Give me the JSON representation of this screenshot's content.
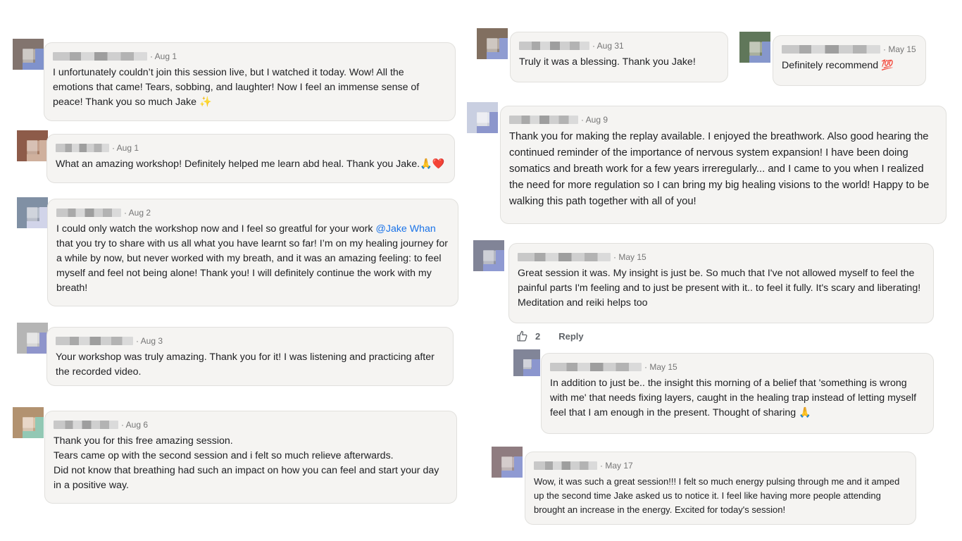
{
  "comments": [
    {
      "id": "c1",
      "date": "· Aug 1",
      "text": "I unfortunately couldn’t join this session live, but I watched it today. Wow! All the emotions that came! Tears, sobbing, and laughter! Now I feel an immense sense of peace! Thank you so much Jake ✨"
    },
    {
      "id": "c2",
      "date": "· Aug 1",
      "text": "What an amazing workshop! Definitely helped me learn abd heal. Thank you Jake.🙏❤️"
    },
    {
      "id": "c3",
      "date": "· Aug 2",
      "text_before": "I could only watch the workshop now and I feel so greatful for your work ",
      "mention": "@Jake Whan",
      "text_after": " that you try to share with us all what you have learnt so far! I’m on my healing journey for a while by now, but never worked with my breath, and it was an amazing feeling: to feel myself and feel not being alone! Thank you! I will definitely continue the work with my breath!"
    },
    {
      "id": "c4",
      "date": "· Aug 3",
      "text": "Your workshop was truly amazing. Thank you for it! I was listening and practicing after the recorded video."
    },
    {
      "id": "c5",
      "date": "· Aug 6",
      "lines": [
        "Thank you for this free amazing session.",
        "Tears came op with the second session and i felt so much relieve afterwards.",
        "Did not know that breathing had such an impact on how you can feel and start your day in a positive way."
      ]
    },
    {
      "id": "c6",
      "date": "· Aug 31",
      "text": "Truly it was a blessing. Thank you Jake!"
    },
    {
      "id": "c7",
      "date": "· May 15",
      "text": "Definitely recommend 💯"
    },
    {
      "id": "c8",
      "date": "· Aug 9",
      "text": "Thank you for making the replay available. I enjoyed the breathwork. Also good hearing the continued reminder of the importance of nervous system expansion! I have been doing somatics and breath work for a few years irreregularly... and I came to you when I realized the need for more regulation so I can bring my big healing visions to the world! Happy to be walking this path together with all of you!"
    },
    {
      "id": "c9",
      "date": "· May 15",
      "text": "Great session it was. My insight is just be. So much that I've not allowed myself to feel the painful parts I'm feeling and to just be present with it.. to feel it fully. It's scary and liberating! Meditation and reiki helps too"
    },
    {
      "id": "c10",
      "date": "· May 15",
      "text": "In addition to just be.. the insight this morning of a belief that 'something is wrong with me' that needs fixing layers, caught in the healing trap instead of letting myself feel that I am enough in the present. Thought of sharing 🙏"
    },
    {
      "id": "c11",
      "date": "· May 17",
      "text": "Wow, it was such a great session!!! I felt so much energy pulsing through me and it amped up the second time Jake asked us to notice it. I feel like having more people attending brought an increase in the energy. Excited for today's session!"
    }
  ],
  "actions": {
    "like_count": "2",
    "reply_label": "Reply",
    "like_icon": "thumbs-up-icon"
  },
  "colors": {
    "bubble_bg": "#f5f4f2",
    "mention": "#1a73e8"
  }
}
